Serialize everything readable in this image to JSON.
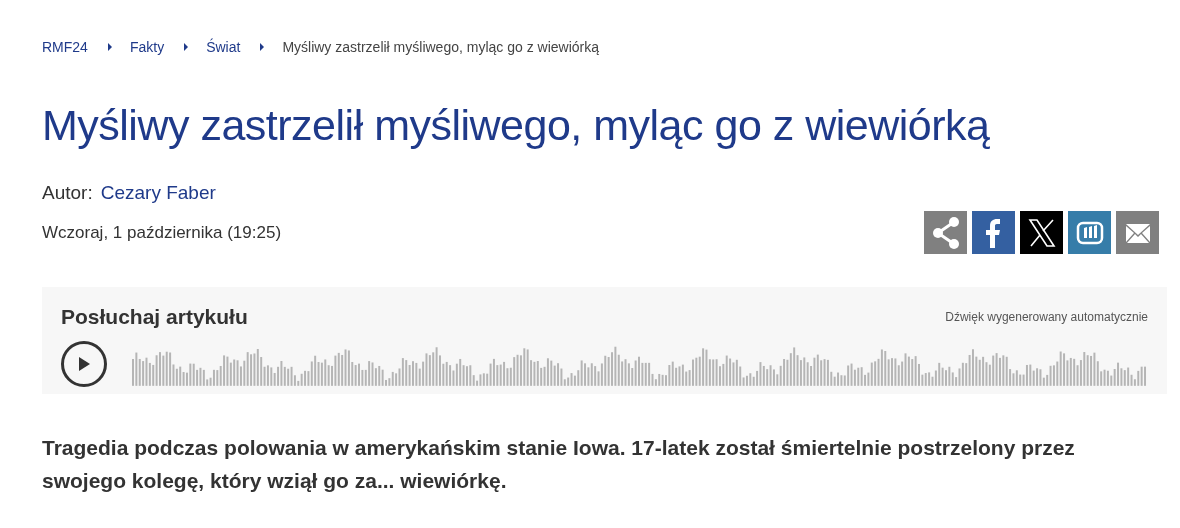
{
  "breadcrumb": [
    {
      "label": "RMF24",
      "kind": "link"
    },
    {
      "label": "Fakty",
      "kind": "link"
    },
    {
      "label": "Świat",
      "kind": "link"
    },
    {
      "label": "Myśliwy zastrzelił myśliwego, myląc go z wiewiórką",
      "kind": "current"
    }
  ],
  "title": "Myśliwy zastrzelił myśliwego, myląc go z wiewiórką",
  "author": {
    "label": "Autor:",
    "name": "Cezary Faber"
  },
  "date": "Wczoraj, 1 października (19:25)",
  "share_buttons": [
    {
      "kind": "share",
      "color": "#808080"
    },
    {
      "kind": "facebook",
      "color": "#3460a1"
    },
    {
      "kind": "x",
      "color": "#000000"
    },
    {
      "kind": "wykop",
      "color": "#367da9"
    },
    {
      "kind": "email",
      "color": "#808080"
    }
  ],
  "audio_player": {
    "title": "Posłuchaj artykułu",
    "note": "Dźwięk wygenerowany automatycznie"
  },
  "lead": "Tragedia podczas polowania w amerykańskim stanie Iowa. 17-latek został śmiertelnie postrzelony przez swojego kolegę, który wziął go za... wiewiórkę."
}
